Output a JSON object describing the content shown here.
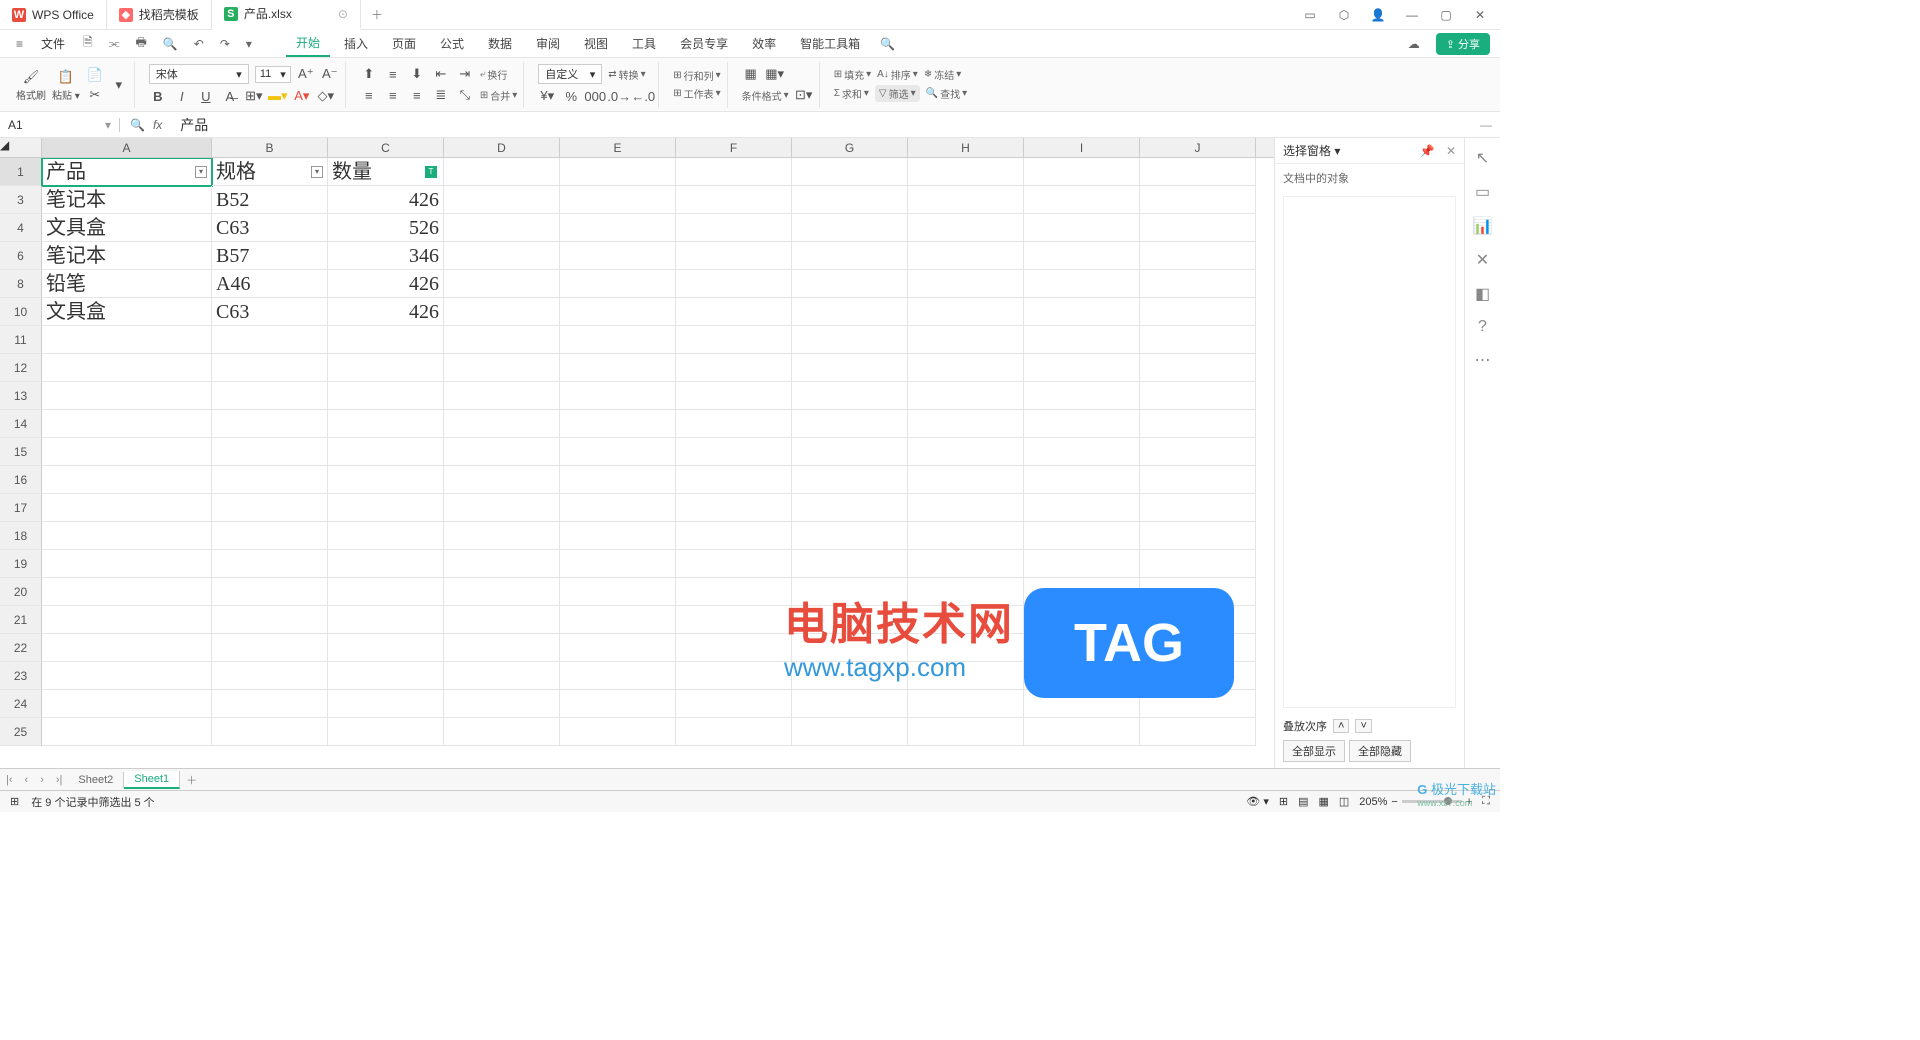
{
  "tabs": [
    {
      "icon": "W",
      "label": "WPS Office"
    },
    {
      "icon": "D",
      "label": "找稻壳模板"
    },
    {
      "icon": "S",
      "label": "产品.xlsx"
    }
  ],
  "menu": {
    "file": "文件",
    "items": [
      "开始",
      "插入",
      "页面",
      "公式",
      "数据",
      "审阅",
      "视图",
      "工具",
      "会员专享",
      "效率",
      "智能工具箱"
    ],
    "active": "开始",
    "share": "⇪ 分享"
  },
  "ribbon": {
    "format_brush": "格式刷",
    "paste": "粘贴",
    "font_name": "宋体",
    "font_size": "11",
    "wrap": "换行",
    "merge": "合并",
    "custom": "自定义",
    "transpose": "转换",
    "rowcol": "行和列",
    "worksheet": "工作表",
    "cond_format": "条件格式",
    "fill": "填充",
    "sort": "排序",
    "freeze": "冻结",
    "sum": "求和",
    "filter": "筛选",
    "find": "查找"
  },
  "formula": {
    "cell_ref": "A1",
    "value": "产品"
  },
  "columns": [
    "A",
    "B",
    "C",
    "D",
    "E",
    "F",
    "G",
    "H",
    "I",
    "J"
  ],
  "row_numbers": [
    1,
    3,
    4,
    6,
    8,
    10,
    11,
    12,
    13,
    14,
    15,
    16,
    17,
    18,
    19,
    20,
    21,
    22,
    23,
    24,
    25
  ],
  "headers": {
    "A": "产品",
    "B": "规格",
    "C": "数量"
  },
  "data_rows": [
    {
      "A": "笔记本",
      "B": "B52",
      "C": "426"
    },
    {
      "A": "文具盒",
      "B": "C63",
      "C": "526"
    },
    {
      "A": "笔记本",
      "B": "B57",
      "C": "346"
    },
    {
      "A": "铅笔",
      "B": "A46",
      "C": "426"
    },
    {
      "A": "文具盒",
      "B": "C63",
      "C": "426"
    }
  ],
  "panel": {
    "title": "选择窗格",
    "subtitle": "文档中的对象",
    "stack": "叠放次序",
    "show_all": "全部显示",
    "hide_all": "全部隐藏"
  },
  "sheets": {
    "list": [
      "Sheet2",
      "Sheet1"
    ],
    "active": "Sheet1"
  },
  "status": {
    "text": "在 9 个记录中筛选出 5 个",
    "zoom": "205%"
  },
  "watermark": {
    "text": "电脑技术网",
    "url": "www.tagxp.com",
    "tag": "TAG",
    "jiguang": "极光下载站",
    "jiguang_sub": "www.xz7.com"
  }
}
